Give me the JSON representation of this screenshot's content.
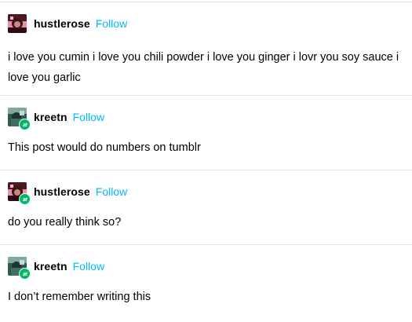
{
  "colors": {
    "follow_link": "#00b8ff",
    "reblog_badge": "#00b865",
    "divider": "#e2e2e2"
  },
  "posts": [
    {
      "username": "hustlerose",
      "follow_label": "Follow",
      "avatar": "hustlerose-avatar",
      "reblog_icon": false,
      "text": "i love you cumin i love you chili powder i love you ginger i lovr you soy sauce i love you garlic"
    },
    {
      "username": "kreetn",
      "follow_label": "Follow",
      "avatar": "kreetn-avatar",
      "reblog_icon": true,
      "text": "This post would do numbers on tumblr"
    },
    {
      "username": "hustlerose",
      "follow_label": "Follow",
      "avatar": "hustlerose-avatar",
      "reblog_icon": true,
      "text": "do you really think so?"
    },
    {
      "username": "kreetn",
      "follow_label": "Follow",
      "avatar": "kreetn-avatar",
      "reblog_icon": true,
      "text": "I don’t remember writing this"
    }
  ]
}
